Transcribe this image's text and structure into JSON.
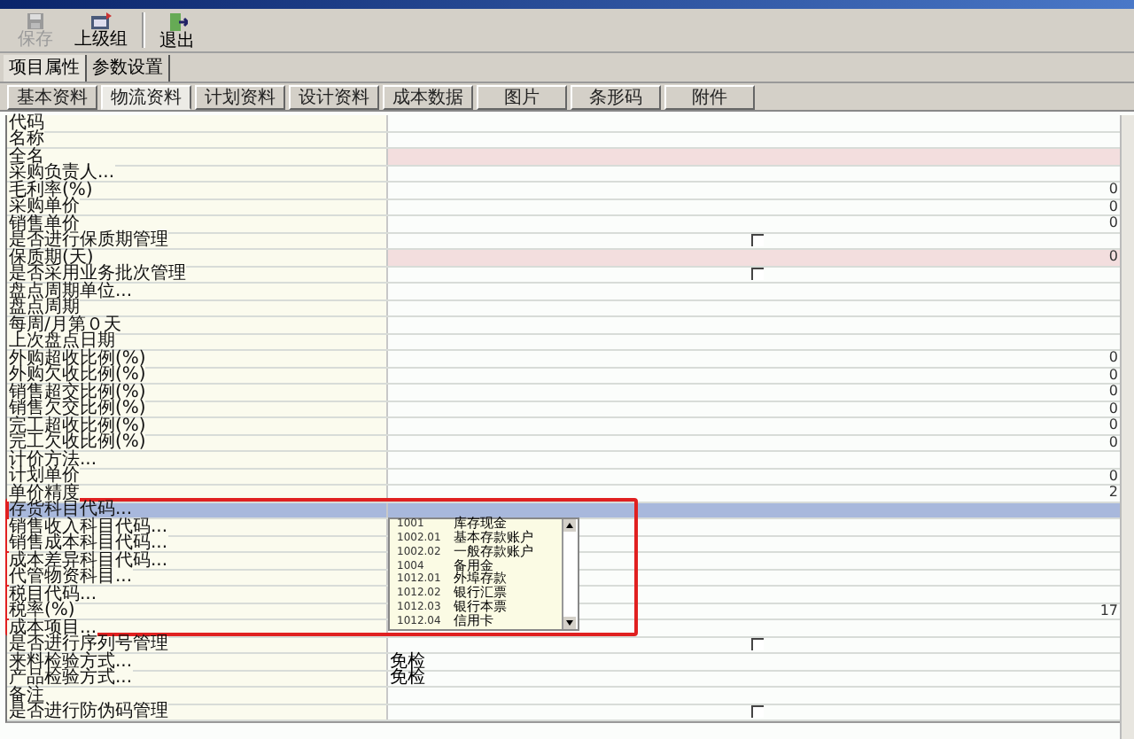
{
  "toolbar": [
    {
      "label": "保存",
      "disabled": true
    },
    {
      "label": "上级组",
      "disabled": false
    },
    {
      "label": "退出",
      "disabled": false
    }
  ],
  "subtabs": [
    {
      "label": "项目属性",
      "selected": true
    },
    {
      "label": "参数设置",
      "selected": false
    }
  ],
  "tabs": [
    {
      "label": "基本资料",
      "selected": false
    },
    {
      "label": "物流资料",
      "selected": true
    },
    {
      "label": "计划资料",
      "selected": false
    },
    {
      "label": "设计资料",
      "selected": false
    },
    {
      "label": "成本数据",
      "selected": false
    },
    {
      "label": "图片",
      "selected": false
    },
    {
      "label": "条形码",
      "selected": false
    },
    {
      "label": "附件",
      "selected": false
    }
  ],
  "rows": [
    {
      "label": "代码",
      "kind": "text"
    },
    {
      "label": "名称",
      "kind": "text"
    },
    {
      "label": "全名",
      "kind": "text",
      "required": true
    },
    {
      "label": "采购负责人...",
      "kind": "text"
    },
    {
      "label": "毛利率(%)",
      "kind": "number",
      "value": "0"
    },
    {
      "label": "采购单价",
      "kind": "number",
      "value": "0"
    },
    {
      "label": "销售单价",
      "kind": "number",
      "value": "0"
    },
    {
      "label": "是否进行保质期管理",
      "kind": "check",
      "checked": false
    },
    {
      "label": "保质期(天)",
      "kind": "number",
      "value": "0",
      "required": true
    },
    {
      "label": "是否采用业务批次管理",
      "kind": "check",
      "checked": false
    },
    {
      "label": "盘点周期单位...",
      "kind": "text"
    },
    {
      "label": "盘点周期",
      "kind": "text"
    },
    {
      "label": "每周/月第０天",
      "kind": "text"
    },
    {
      "label": "上次盘点日期",
      "kind": "text"
    },
    {
      "label": "外购超收比例(%)",
      "kind": "number",
      "value": "0"
    },
    {
      "label": "外购欠收比例(%)",
      "kind": "number",
      "value": "0"
    },
    {
      "label": "销售超交比例(%)",
      "kind": "number",
      "value": "0"
    },
    {
      "label": "销售欠交比例(%)",
      "kind": "number",
      "value": "0"
    },
    {
      "label": "完工超收比例(%)",
      "kind": "number",
      "value": "0"
    },
    {
      "label": "完工欠收比例(%)",
      "kind": "number",
      "value": "0"
    },
    {
      "label": "计价方法...",
      "kind": "text"
    },
    {
      "label": "计划单价",
      "kind": "number",
      "value": "0"
    },
    {
      "label": "单价精度",
      "kind": "number",
      "value": "2"
    },
    {
      "label": "存货科目代码...",
      "kind": "text",
      "selected": true
    },
    {
      "label": "销售收入科目代码...",
      "kind": "text"
    },
    {
      "label": "销售成本科目代码...",
      "kind": "text"
    },
    {
      "label": "成本差异科目代码...",
      "kind": "text"
    },
    {
      "label": "代管物资科目...",
      "kind": "text"
    },
    {
      "label": "税目代码...",
      "kind": "text"
    },
    {
      "label": "税率(%)",
      "kind": "number",
      "value": "17"
    },
    {
      "label": "成本项目...",
      "kind": "text"
    },
    {
      "label": "是否进行序列号管理",
      "kind": "check",
      "checked": false
    },
    {
      "label": "来料检验方式...",
      "kind": "text",
      "value": "免检"
    },
    {
      "label": "产品检验方式...",
      "kind": "text",
      "value": "免检"
    },
    {
      "label": "备注",
      "kind": "text"
    },
    {
      "label": "是否进行防伪码管理",
      "kind": "check",
      "checked": false
    }
  ],
  "dropdown": {
    "items": [
      {
        "code": "1001",
        "name": "库存现金"
      },
      {
        "code": "1002.01",
        "name": "基本存款账户"
      },
      {
        "code": "1002.02",
        "name": "一般存款账户"
      },
      {
        "code": "1004",
        "name": "备用金"
      },
      {
        "code": "1012.01",
        "name": "外埠存款"
      },
      {
        "code": "1012.02",
        "name": "银行汇票"
      },
      {
        "code": "1012.03",
        "name": "银行本票"
      },
      {
        "code": "1012.04",
        "name": "信用卡"
      }
    ]
  }
}
